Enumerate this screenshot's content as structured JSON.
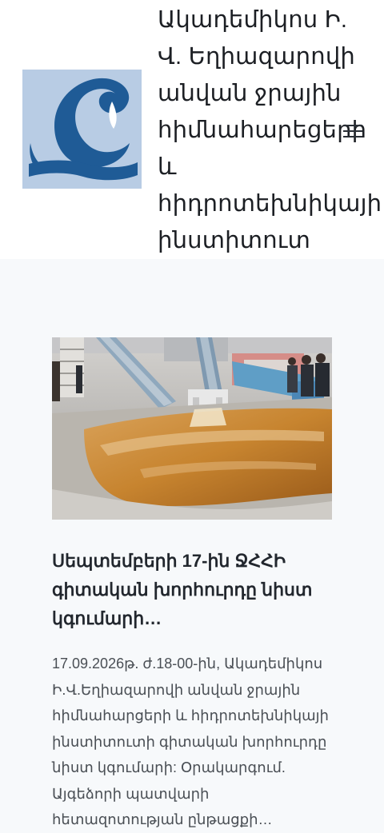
{
  "header": {
    "site_title": "Ակադեմիկոս Ի. Վ. Եղիազարովի անվան ջրային հիմնահարեցերի և հիդրոտեխնիկայի ինստիտուտ",
    "logo_icon": "institute-logo",
    "menu_icon": "hamburger-menu-icon",
    "colors": {
      "logo_bg": "#b8cce4",
      "logo_mark": "#1f5b96"
    }
  },
  "post": {
    "title": "Սեպտեմբերի 17-ին ՋՀՀԻ գիտական խորհուրդը նիստ կգումարի…",
    "excerpt": "17.09.2026թ. ժ.18-00-ին, Ակադեմիկոս Ի.Վ.Եղիազարովի անվան ջրային հիմնահարցերի և հիդրոտեխնիկայի ինստիտուտի գիտական խորհուրդը նիստ կգումարի: Օրակարգում. Այգեձորի պատվարի հետազոտության ընթացքի…",
    "image": "laboratory-water-flume-photo"
  }
}
